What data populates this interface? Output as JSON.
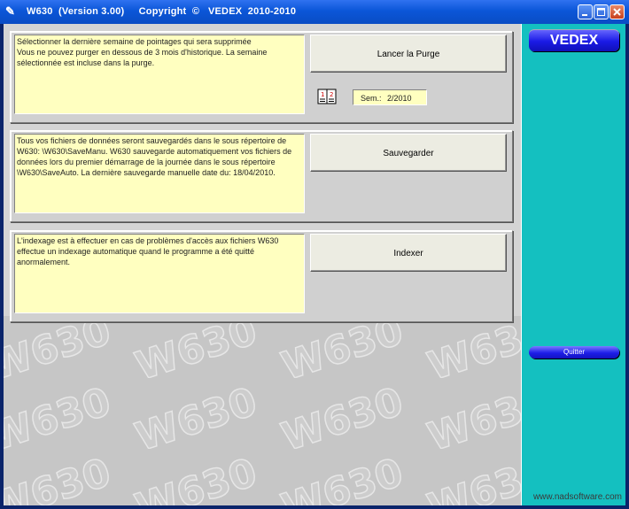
{
  "window": {
    "title": "W630  (Version 3.00)     Copyright  ©   VEDEX  2010-2010"
  },
  "panels": {
    "purge": {
      "text": "  Sélectionner la dernière semaine de pointages qui sera supprimée\nVous ne pouvez purger en dessous de 3 mois d'historique. La semaine sélectionnée est incluse dans la purge.",
      "button": "Lancer la Purge",
      "week_label": "Sem.:",
      "week_value": "2/2010"
    },
    "save": {
      "text": "  Tous vos fichiers de données seront sauvegardés dans le sous répertoire de W630: \\W630\\SaveManu. W630 sauvegarde automatiquement vos fichiers de données lors du premier démarrage de la journée dans le sous répertoire \\W630\\SaveAuto. La dernière sauvegarde manuelle date du: 18/04/2010.",
      "button": "Sauvegarder"
    },
    "index": {
      "text": "  L'indexage est à effectuer en cas de problèmes d'accès aux fichiers W630 effectue un indexage automatique quand le programme a été quitté anormalement.",
      "button": "Indexer"
    }
  },
  "sidebar": {
    "logo": "VEDEX",
    "quit": "Quitter"
  },
  "watermark": {
    "text": "W630"
  },
  "footer": {
    "text": "www.nadsoftware.com"
  }
}
